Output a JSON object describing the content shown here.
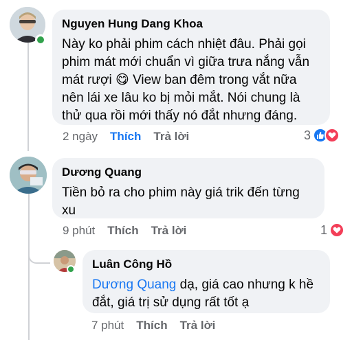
{
  "comments": [
    {
      "author": "Nguyen Hung Dang Khoa",
      "lines": [
        "Này ko phải phim cách nhiệt đâu. Phải gọi",
        "phim mát mới chuẩn vì giữa trưa nắng vẫn",
        "mát rượi",
        "View ban đêm trong vắt nữa",
        "nên lái xe lâu ko bị mỏi mắt. Nói chung là",
        "thử qua rồi mới thấy nó đắt nhưng đáng."
      ],
      "time": "2 ngày",
      "like_label": "Thích",
      "reply_label": "Trả lời",
      "reaction_count": "3",
      "emoji": "😋"
    },
    {
      "author": "Dương Quang",
      "lines": [
        "Tiền bỏ ra cho phim này giá trik đến từng",
        "xu"
      ],
      "time": "9 phút",
      "like_label": "Thích",
      "reply_label": "Trả lời",
      "reaction_count": "1"
    },
    {
      "author": "Luân Công Hồ",
      "mention": "Dương Quang",
      "lines": [
        " dạ, giá cao nhưng k hề",
        "đắt, giá trị sử dụng rất tốt ạ"
      ],
      "time": "7 phút",
      "like_label": "Thích",
      "reply_label": "Trả lời"
    }
  ],
  "colors": {
    "bubble": "#f0f2f5",
    "meta": "#65676b",
    "accent": "#1877f2",
    "love": "#f33e58",
    "online": "#31a24c"
  },
  "icons": [
    "like-reaction-icon",
    "love-reaction-icon",
    "online-status-icon"
  ]
}
